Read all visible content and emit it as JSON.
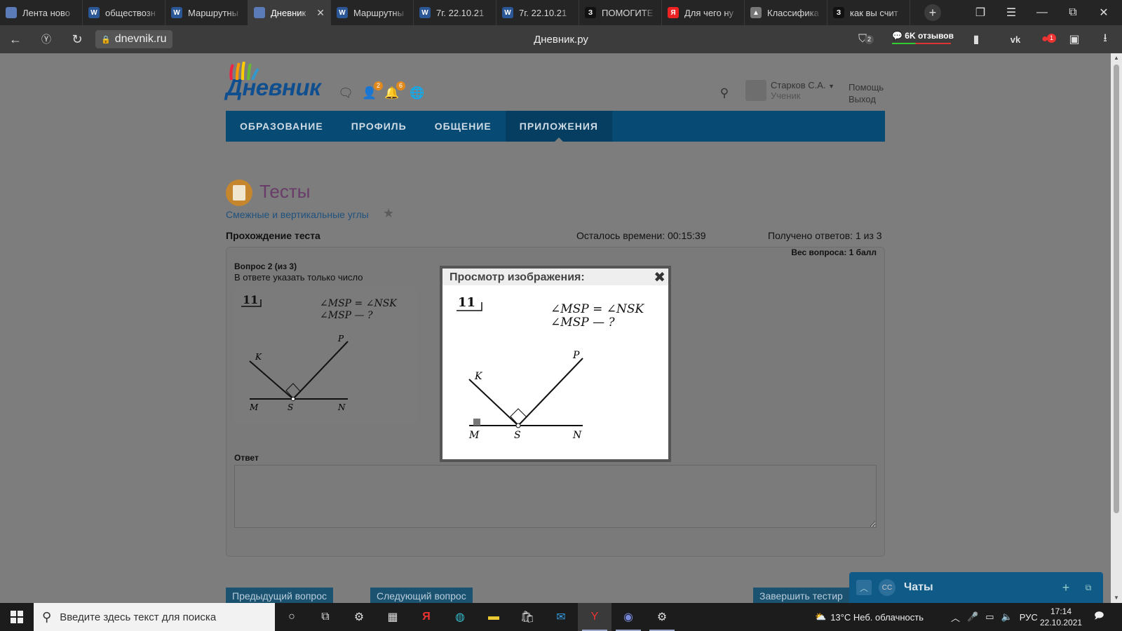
{
  "browser": {
    "tabs": [
      {
        "title": "Лента ново",
        "favicon": "dnevnik-hand-icon",
        "color": "#5a7ab8",
        "glyph": "",
        "active": false
      },
      {
        "title": "обществозн",
        "favicon": "word-icon",
        "color": "#2b5797",
        "glyph": "W",
        "active": false
      },
      {
        "title": "Маршрутны",
        "favicon": "word-icon",
        "color": "#2b5797",
        "glyph": "W",
        "active": false
      },
      {
        "title": "Дневник",
        "favicon": "dnevnik-hand-icon",
        "color": "#5a7ab8",
        "glyph": "",
        "active": true
      },
      {
        "title": "Маршрутны",
        "favicon": "word-icon",
        "color": "#2b5797",
        "glyph": "W",
        "active": false
      },
      {
        "title": "7г. 22.10.21",
        "favicon": "word-icon",
        "color": "#2b5797",
        "glyph": "W",
        "active": false
      },
      {
        "title": "7г. 22.10.21",
        "favicon": "word-icon",
        "color": "#2b5797",
        "glyph": "W",
        "active": false
      },
      {
        "title": "ПОМОГИТЕ",
        "favicon": "znanija-icon",
        "color": "#111",
        "glyph": "З",
        "active": false
      },
      {
        "title": "Для чего ну",
        "favicon": "yandex-icon",
        "color": "#e22",
        "glyph": "Я",
        "active": false
      },
      {
        "title": "Классифика",
        "favicon": "mountain-icon",
        "color": "#777",
        "glyph": "▲",
        "active": false
      },
      {
        "title": "как вы счит",
        "favicon": "znanija-icon",
        "color": "#111",
        "glyph": "З",
        "active": false
      }
    ],
    "url": "dnevnik.ru",
    "page_title": "Дневник.ру",
    "reviews_label": "6K отзывов",
    "downloads_badge": "2",
    "ext_badge": "1"
  },
  "header": {
    "logo_text": "Дневник",
    "friends_badge": "2",
    "notif_badge": "6",
    "user_name": "Старков С.А.",
    "user_role": "Ученик",
    "help_label": "Помощь",
    "logout_label": "Выход"
  },
  "nav": {
    "items": [
      "ОБРАЗОВАНИЕ",
      "ПРОФИЛЬ",
      "ОБЩЕНИЕ",
      "ПРИЛОЖЕНИЯ"
    ],
    "active": "ПРИЛОЖЕНИЯ"
  },
  "test": {
    "section_title": "Тесты",
    "subtitle": "Смежные и вертикальные углы",
    "pass_label": "Прохождение теста",
    "time_left": "Осталось времени: 00:15:39",
    "answers_received": "Получено ответов: 1 из 3",
    "weight": "Вес вопроса: 1 балл",
    "question_num": "Вопрос 2 (из 3)",
    "question_text": "В ответе указать только число",
    "answer_label": "Ответ",
    "answer_value": "",
    "figure": {
      "number": "11",
      "line1": "∠MSP = ∠NSK",
      "line2": "∠MSP — ?",
      "labels": {
        "K": "K",
        "P": "P",
        "M": "M",
        "S": "S",
        "N": "N"
      }
    },
    "buttons": {
      "prev": "Предыдущий вопрос",
      "next": "Следующий вопрос",
      "finish": "Завершить тестир"
    }
  },
  "modal": {
    "title": "Просмотр изображения:"
  },
  "chat": {
    "avatar_initials": "CC",
    "label": "Чаты"
  },
  "taskbar": {
    "search_placeholder": "Введите здесь текст для поиска",
    "weather": "13°C  Неб. облачность",
    "lang": "РУС",
    "time": "17:14",
    "date": "22.10.2021"
  }
}
